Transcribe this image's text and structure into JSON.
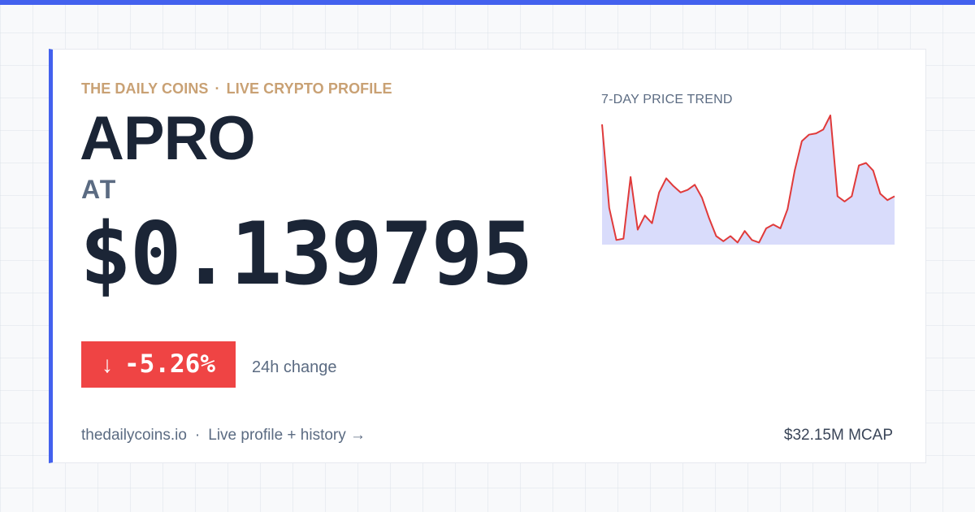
{
  "header": {
    "brand": "THE DAILY COINS",
    "separator": "·",
    "section": "LIVE CRYPTO PROFILE"
  },
  "coin": {
    "name": "APRO",
    "symbol": "AT",
    "price": "$0.139795"
  },
  "change": {
    "arrow": "↓",
    "value": "-5.26%",
    "label": "24h change"
  },
  "trend": {
    "title": "7-DAY PRICE TREND",
    "line_color": "#e03a3a",
    "fill_color": "#d9dcfb",
    "points": [
      0.93,
      0.28,
      0.03,
      0.04,
      0.52,
      0.11,
      0.22,
      0.16,
      0.4,
      0.51,
      0.45,
      0.4,
      0.42,
      0.46,
      0.36,
      0.2,
      0.06,
      0.02,
      0.06,
      0.01,
      0.1,
      0.03,
      0.01,
      0.12,
      0.15,
      0.12,
      0.27,
      0.57,
      0.8,
      0.85,
      0.86,
      0.89,
      1.0,
      0.37,
      0.33,
      0.37,
      0.61,
      0.63,
      0.57,
      0.39,
      0.34,
      0.37
    ]
  },
  "footer": {
    "site": "thedailycoins.io",
    "separator": "·",
    "link": "Live profile + history →",
    "mcap": "$32.15M MCAP"
  },
  "colors": {
    "accent": "#4361ee",
    "negative": "#ef4444",
    "eyebrow": "#c9a174"
  }
}
